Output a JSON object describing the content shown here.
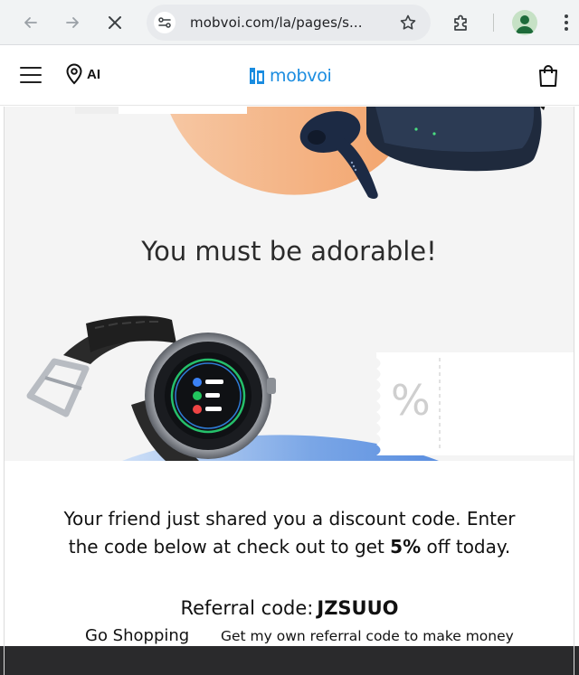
{
  "browser": {
    "url": "mobvoi.com/la/pages/s...",
    "back_icon": "arrow-left-icon",
    "forward_icon": "arrow-right-icon",
    "stop_icon": "close-icon",
    "site_info_icon": "tune-icon",
    "bookmark_icon": "star-icon",
    "extensions_icon": "puzzle-icon",
    "profile_icon": "person-icon",
    "menu_icon": "more-vertical-icon"
  },
  "header": {
    "menu_icon": "hamburger-icon",
    "location_icon": "location-pin-icon",
    "country_code": "AI",
    "logo_text": "mobvoi",
    "cart_icon": "shopping-bag-icon",
    "brand_color": "#1a8ce0"
  },
  "hero": {
    "headline": "You must be adorable!",
    "coupon_symbol": "%"
  },
  "message": {
    "line1": "Your friend just shared you a discount code. Enter",
    "line2_before": "the code below at check out to get ",
    "discount": "5%",
    "line2_after": " off today."
  },
  "referral": {
    "label": "Referral code:",
    "code": "JZSUUO"
  },
  "links": {
    "go_shopping": "Go Shopping",
    "own_code": "Get my own referral code to make money"
  }
}
